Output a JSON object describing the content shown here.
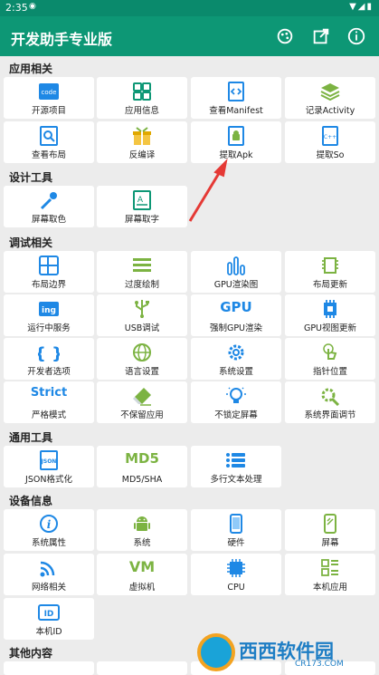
{
  "status": {
    "time": "2:35",
    "dot": "◉",
    "sys": "▼◢▮"
  },
  "app": {
    "title": "开发助手专业版"
  },
  "colors": {
    "accent": "#0d9775",
    "tile_bg": "#ffffff",
    "bg": "#ececec",
    "arrow": "#e53935"
  },
  "sections": {
    "app": "应用相关",
    "design": "设计工具",
    "debug": "调试相关",
    "general": "通用工具",
    "device": "设备信息",
    "other": "其他内容"
  },
  "tiles": {
    "open_source": "开源项目",
    "app_info": "应用信息",
    "manifest": "查看Manifest",
    "record_activity": "记录Activity",
    "view_layout": "查看布局",
    "decompile": "反编译",
    "extract_apk": "提取Apk",
    "extract_so": "提取So",
    "color_pick": "屏幕取色",
    "text_pick": "屏幕取字",
    "layout_bounds": "布局边界",
    "overdraw": "过度绘制",
    "gpu_render": "GPU渲染图",
    "layout_update": "布局更新",
    "running_services": "运行中服务",
    "usb_debug": "USB调试",
    "force_gpu": "强制GPU渲染",
    "gpu_view_update": "GPU视图更新",
    "dev_options": "开发者选项",
    "language": "语言设置",
    "system_settings": "系统设置",
    "pointer_location": "指针位置",
    "strict_mode": "严格模式",
    "no_keep_activities": "不保留应用",
    "stay_awake": "不锁定屏幕",
    "system_ui_tuner": "系统界面调节",
    "json_format": "JSON格式化",
    "md5_sha": "MD5/SHA",
    "multiline_text": "多行文本处理",
    "sys_props": "系统属性",
    "system": "系统",
    "hardware": "硬件",
    "screen": "屏幕",
    "network": "网络相关",
    "vm": "虚拟机",
    "cpu": "CPU",
    "local_apps": "本机应用",
    "device_id": "本机ID"
  },
  "icon_text": {
    "code": "code",
    "ing": "ing",
    "gpu": "GPU",
    "strict": "Strict",
    "json": "JSON",
    "md5": "MD5",
    "vm": "VM",
    "id": "ID"
  },
  "watermark": {
    "text": "西西软件园",
    "url": "CR173.COM"
  }
}
